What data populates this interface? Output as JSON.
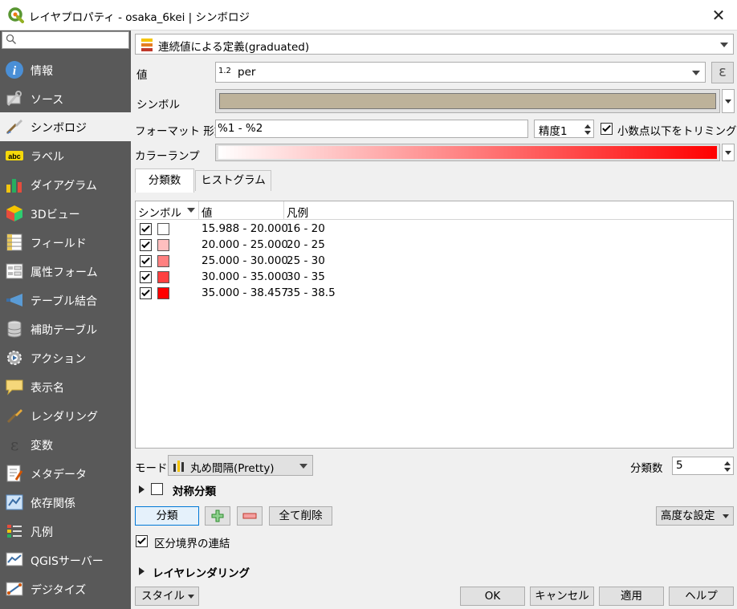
{
  "window": {
    "title": "レイヤプロパティ - osaka_6kei | シンボロジ"
  },
  "sidebar": {
    "search_placeholder": "",
    "items": [
      {
        "label": "情報",
        "icon": "info-icon",
        "active": false
      },
      {
        "label": "ソース",
        "icon": "source-wrench-icon",
        "active": false
      },
      {
        "label": "シンボロジ",
        "icon": "paintbrush-icon",
        "active": true
      },
      {
        "label": "ラベル",
        "icon": "abc-label-icon",
        "active": false
      },
      {
        "label": "ダイアグラム",
        "icon": "diagram-icon",
        "active": false
      },
      {
        "label": "3Dビュー",
        "icon": "cube-icon",
        "active": false
      },
      {
        "label": "フィールド",
        "icon": "fields-icon",
        "active": false
      },
      {
        "label": "属性フォーム",
        "icon": "form-icon",
        "active": false
      },
      {
        "label": "テーブル結合",
        "icon": "join-icon",
        "active": false
      },
      {
        "label": "補助テーブル",
        "icon": "database-icon",
        "active": false
      },
      {
        "label": "アクション",
        "icon": "action-gear-icon",
        "active": false
      },
      {
        "label": "表示名",
        "icon": "speech-bubble-icon",
        "active": false
      },
      {
        "label": "レンダリング",
        "icon": "brush-icon",
        "active": false
      },
      {
        "label": "変数",
        "icon": "epsilon-icon",
        "active": false
      },
      {
        "label": "メタデータ",
        "icon": "metadata-icon",
        "active": false
      },
      {
        "label": "依存関係",
        "icon": "dependency-icon",
        "active": false
      },
      {
        "label": "凡例",
        "icon": "legend-icon",
        "active": false
      },
      {
        "label": "QGISサーバー",
        "icon": "server-icon",
        "active": false
      },
      {
        "label": "デジタイズ",
        "icon": "digitize-icon",
        "active": false
      }
    ]
  },
  "renderer": {
    "selected": "連続値による定義(graduated)"
  },
  "value_field": {
    "label": "値",
    "type_badge": "1.2",
    "value": "per"
  },
  "symbol": {
    "label": "シンボル",
    "color": "#bdb29a"
  },
  "format": {
    "label": "フォーマット 形式",
    "value": "%1 - %2",
    "precision_label": "精度1",
    "trim_label": "小数点以下をトリミング",
    "trim_checked": true
  },
  "color_ramp": {
    "label": "カラーランプ",
    "start": "#ffffff",
    "end": "#ff0000"
  },
  "tabs": [
    {
      "label": "分類数",
      "active": true
    },
    {
      "label": "ヒストグラム",
      "active": false
    }
  ],
  "table": {
    "headers": {
      "symbol": "シンボル",
      "value": "値",
      "legend": "凡例"
    },
    "rows": [
      {
        "checked": true,
        "color": "#ffffff",
        "value": "15.988 - 20.000",
        "legend": "16 - 20"
      },
      {
        "checked": true,
        "color": "#ffbfbf",
        "value": "20.000 - 25.000",
        "legend": "20 - 25"
      },
      {
        "checked": true,
        "color": "#ff8080",
        "value": "25.000 - 30.000",
        "legend": "25 - 30"
      },
      {
        "checked": true,
        "color": "#ff4040",
        "value": "30.000 - 35.000",
        "legend": "30 - 35"
      },
      {
        "checked": true,
        "color": "#ff0000",
        "value": "35.000 - 38.457",
        "legend": "35 - 38.5"
      }
    ]
  },
  "mode": {
    "label": "モード",
    "value": "丸め間隔(Pretty)",
    "classes_label": "分類数",
    "classes_value": "5"
  },
  "symmetric": {
    "label": "対称分類",
    "checked": false
  },
  "actions": {
    "classify": "分類",
    "delete_all": "全て削除",
    "advanced": "高度な設定"
  },
  "link_boundaries": {
    "label": "区分境界の連結",
    "checked": true
  },
  "layer_rendering": {
    "label": "レイヤレンダリング"
  },
  "footer": {
    "style": "スタイル",
    "ok": "OK",
    "cancel": "キャンセル",
    "apply": "適用",
    "help": "ヘルプ"
  }
}
